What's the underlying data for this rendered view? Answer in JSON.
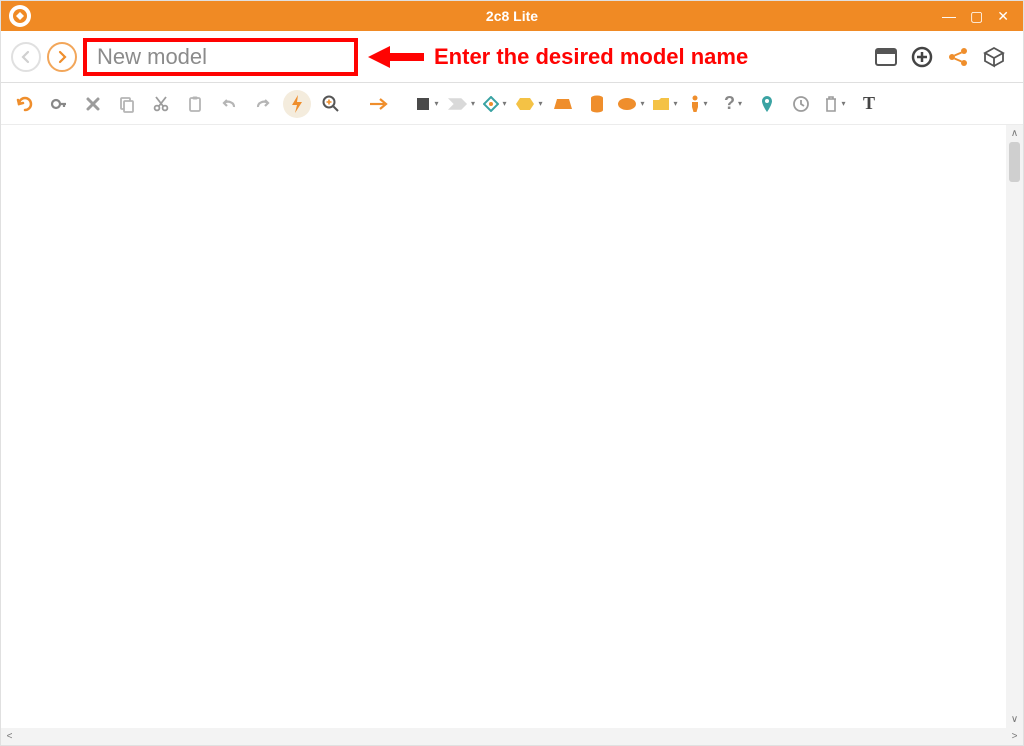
{
  "app": {
    "title": "2c8 Lite"
  },
  "nameField": {
    "value": "New model",
    "placeholder": "New model"
  },
  "annotation": {
    "text": "Enter the desired model name"
  },
  "windowControls": {
    "minimize": "—",
    "maximize": "▢",
    "close": "✕"
  }
}
